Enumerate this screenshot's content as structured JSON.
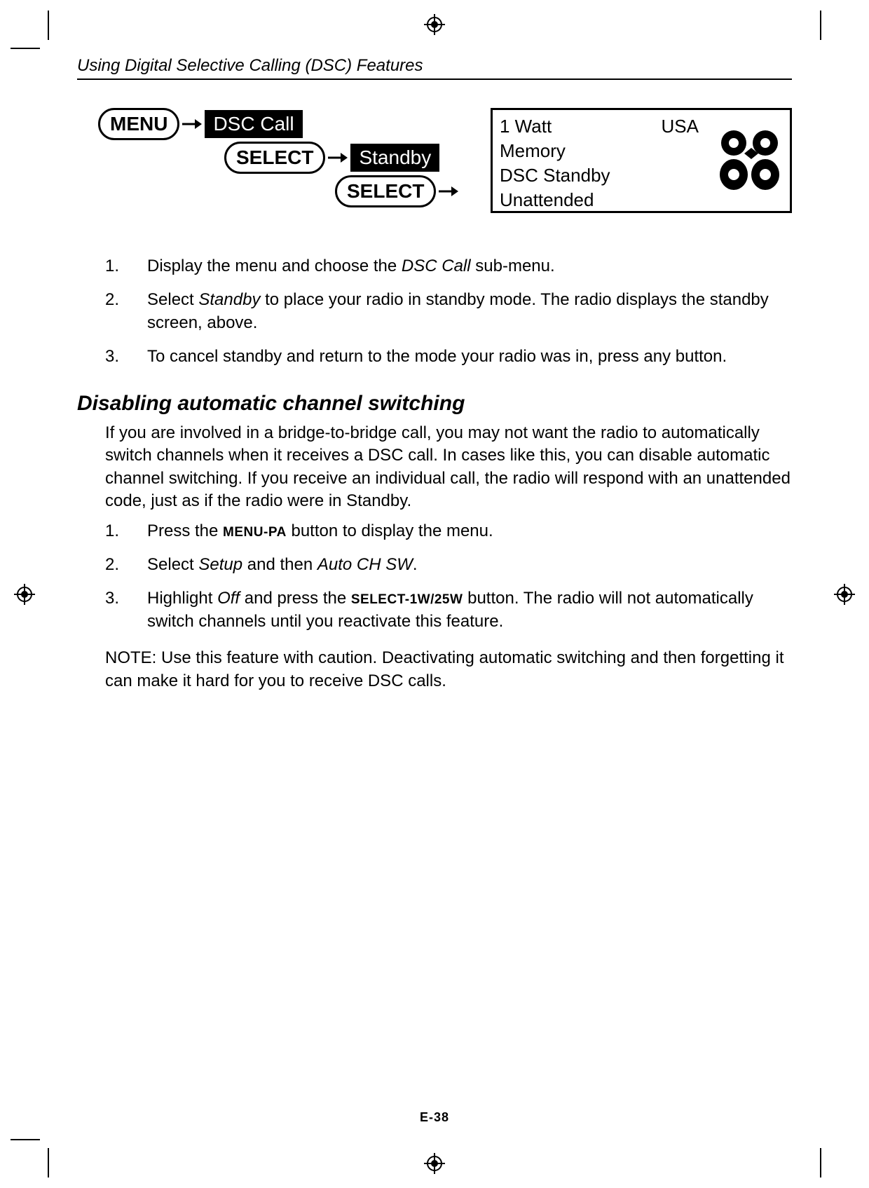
{
  "header": {
    "section_title": "Using Digital Selective Calling (DSC) Features"
  },
  "diagram": {
    "menu_btn": "MENU",
    "dsc_call": "DSC Call",
    "select_btn1": "SELECT",
    "standby": "Standby",
    "select_btn2": "SELECT",
    "lcd": {
      "line1_left": "1 Watt",
      "line1_right": "USA",
      "line2": "Memory",
      "line3": "DSC Standby",
      "line4": " Unattended",
      "channel": "88"
    }
  },
  "steps1": [
    {
      "n": "1.",
      "pre": "Display the menu and choose the ",
      "em": "DSC Call",
      "post": " sub-menu."
    },
    {
      "n": "2.",
      "pre": "Select ",
      "em": "Standby",
      "post": " to place your radio in standby mode. The radio displays the standby screen, above."
    },
    {
      "n": "3.",
      "pre": "To cancel standby and return to the mode your radio was in, press any button.",
      "em": "",
      "post": ""
    }
  ],
  "h2": "Disabling automatic channel switching",
  "para": "If you are involved in a bridge-to-bridge call, you may not want the radio to automatically switch channels when it receives a DSC call. In cases like this, you can disable automatic channel switching. If you receive an individual call, the radio will respond with an unattended code, just as if the radio were in Standby.",
  "steps2": {
    "s1": {
      "n": "1.",
      "pre": "Press the ",
      "btn": "MENU-PA",
      "post": " button to display the menu."
    },
    "s2": {
      "n": "2.",
      "pre": "Select ",
      "em1": "Setup",
      "mid": " and then ",
      "em2": "Auto CH SW",
      "post": "."
    },
    "s3": {
      "n": "3.",
      "pre": "Highlight ",
      "em": "Off",
      "mid": " and press the ",
      "btn": "SELECT-1W/25W",
      "post": " button. The radio will not automatically switch channels until you reactivate this feature."
    }
  },
  "note": "NOTE: Use this feature with caution. Deactivating automatic switching and then forgetting it can make it hard for you to receive DSC calls.",
  "pagenum": "E-38"
}
